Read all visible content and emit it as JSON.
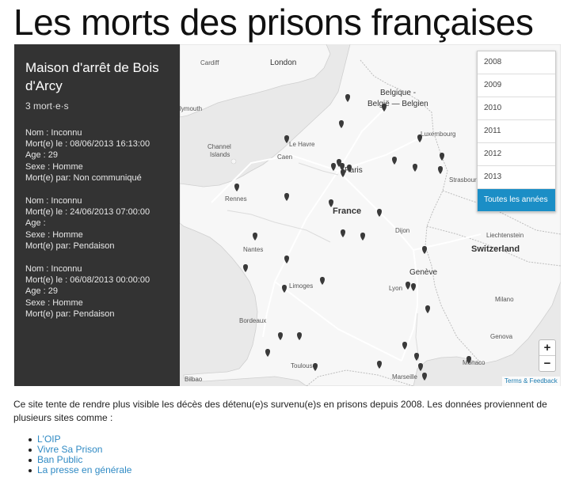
{
  "page": {
    "title": "Les morts des prisons françaises"
  },
  "sidebar": {
    "prison_name": "Maison d'arrêt de Bois d'Arcy",
    "death_count": "3 mort·e·s",
    "deaths": [
      {
        "nom": "Nom : Inconnu",
        "date": "Mort(e) le : 08/06/2013 16:13:00",
        "age": "Age : 29",
        "sexe": "Sexe : Homme",
        "cause": "Mort(e) par: Non communiqué"
      },
      {
        "nom": "Nom : Inconnu",
        "date": "Mort(e) le : 24/06/2013 07:00:00",
        "age": "Age :",
        "sexe": "Sexe : Homme",
        "cause": "Mort(e) par: Pendaison"
      },
      {
        "nom": "Nom : Inconnu",
        "date": "Mort(e) le : 06/08/2013 00:00:00",
        "age": "Age : 29",
        "sexe": "Sexe : Homme",
        "cause": "Mort(e) par: Pendaison"
      }
    ]
  },
  "year_filter": {
    "options": [
      "2008",
      "2009",
      "2010",
      "2011",
      "2012",
      "2013",
      "Toutes les années"
    ],
    "selected": "Toutes les années"
  },
  "map": {
    "labels": {
      "cardiff": "Cardiff",
      "london": "London",
      "belgique": "Belgique -",
      "belgie": "België — Belgien",
      "plymouth": "lymouth",
      "luxembourg": "Luxembourg",
      "channel": "Channel",
      "islands": "Islands",
      "le_havre": "Le Havre",
      "caen": "Caen",
      "paris": "Paris",
      "strasbourg": "Strasbourg",
      "rennes": "Rennes",
      "france": "France",
      "dijon": "Dijon",
      "liechtenstein": "Liechtenstein",
      "switzerland": "Switzerland",
      "nantes": "Nantes",
      "geneve": "Genève",
      "limoges": "Limoges",
      "lyon": "Lyon",
      "milano": "Milano",
      "bordeaux": "Bordeaux",
      "genova": "Genova",
      "toulouse": "Toulouse",
      "bilbao": "Bilbao",
      "marseille": "Marseille",
      "monaco": "Monaco"
    },
    "zoom_in": "+",
    "zoom_out": "−",
    "attribution": "Terms & Feedback",
    "colors": {
      "sea": "#e9e9e9",
      "land": "#f7f7f7",
      "marker": "#3a3a3a",
      "accent": "#1b8ec6",
      "sidebar": "#333333"
    }
  },
  "intro": {
    "text": "Ce site tente de rendre plus visible les décès des détenu(e)s survenu(e)s en prisons depuis 2008. Les données proviennent de plusieurs sites comme :"
  },
  "sources": [
    {
      "label": "L'OIP"
    },
    {
      "label": "Vivre Sa Prison"
    },
    {
      "label": "Ban Public"
    },
    {
      "label": "La presse en générale"
    }
  ]
}
